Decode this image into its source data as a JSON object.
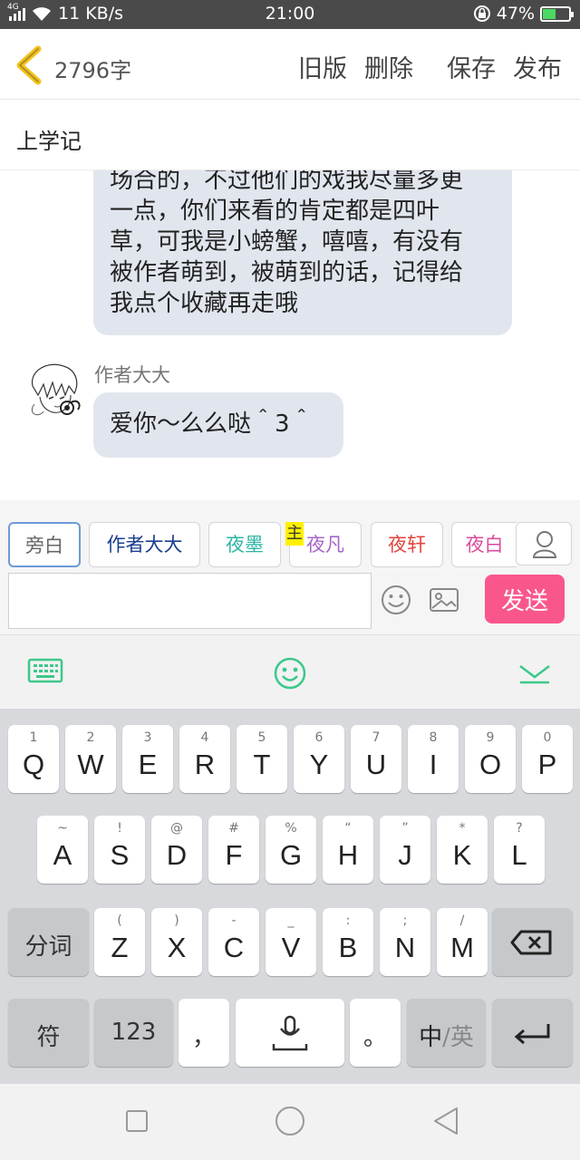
{
  "status_bar": {
    "network": "4G",
    "speed": "11 KB/s",
    "time": "21:00",
    "battery": "47%",
    "battery_level": 0.47
  },
  "header": {
    "word_count": "2796字",
    "old_version": "旧版",
    "delete": "删除",
    "save": "保存",
    "publish": "发布"
  },
  "title": "上学记",
  "messages": [
    {
      "lines": [
        "场合的，不过他们的戏我尽量多更",
        "一点，你们来看的肯定都是四叶",
        "草，可我是小螃蟹，嘻嘻，有没有",
        "被作者萌到，被萌到的话，记得给",
        "我点个收藏再走哦"
      ]
    },
    {
      "author": "作者大大",
      "text": "爱你～么么哒＾3＾"
    }
  ],
  "roles": [
    {
      "label": "旁白",
      "color": "#666666"
    },
    {
      "label": "作者大大",
      "color": "#1a3e8f"
    },
    {
      "label": "夜墨",
      "color": "#2bb5a5"
    },
    {
      "label": "夜凡",
      "color": "#a565c8"
    },
    {
      "label": "夜轩",
      "color": "#e0463c"
    },
    {
      "label": "夜白",
      "color": "#d94c9e"
    }
  ],
  "main_badge": "主",
  "composer": {
    "placeholder": "",
    "send": "发送"
  },
  "keyboard": {
    "row1": [
      {
        "sub": "1",
        "main": "Q"
      },
      {
        "sub": "2",
        "main": "W"
      },
      {
        "sub": "3",
        "main": "E"
      },
      {
        "sub": "4",
        "main": "R"
      },
      {
        "sub": "5",
        "main": "T"
      },
      {
        "sub": "6",
        "main": "Y"
      },
      {
        "sub": "7",
        "main": "U"
      },
      {
        "sub": "8",
        "main": "I"
      },
      {
        "sub": "9",
        "main": "O"
      },
      {
        "sub": "0",
        "main": "P"
      }
    ],
    "row2": [
      {
        "sub": "~",
        "main": "A"
      },
      {
        "sub": "!",
        "main": "S"
      },
      {
        "sub": "@",
        "main": "D"
      },
      {
        "sub": "#",
        "main": "F"
      },
      {
        "sub": "%",
        "main": "G"
      },
      {
        "sub": "“",
        "main": "H"
      },
      {
        "sub": "”",
        "main": "J"
      },
      {
        "sub": "*",
        "main": "K"
      },
      {
        "sub": "?",
        "main": "L"
      }
    ],
    "row3": [
      {
        "sub": "(",
        "main": "Z"
      },
      {
        "sub": ")",
        "main": "X"
      },
      {
        "sub": "-",
        "main": "C"
      },
      {
        "sub": "_",
        "main": "V"
      },
      {
        "sub": ":",
        "main": "B"
      },
      {
        "sub": ";",
        "main": "N"
      },
      {
        "sub": "/",
        "main": "M"
      }
    ],
    "segment": "分词",
    "symbols": "符",
    "numbers": "123",
    "comma": "，",
    "period": "。",
    "lang_cn": "中",
    "lang_sep": "/",
    "lang_en": "英"
  },
  "colors": {
    "send_button": "#f9578c",
    "keyboard_accent": "#3cc88a",
    "bubble": "#e1e6ee"
  }
}
